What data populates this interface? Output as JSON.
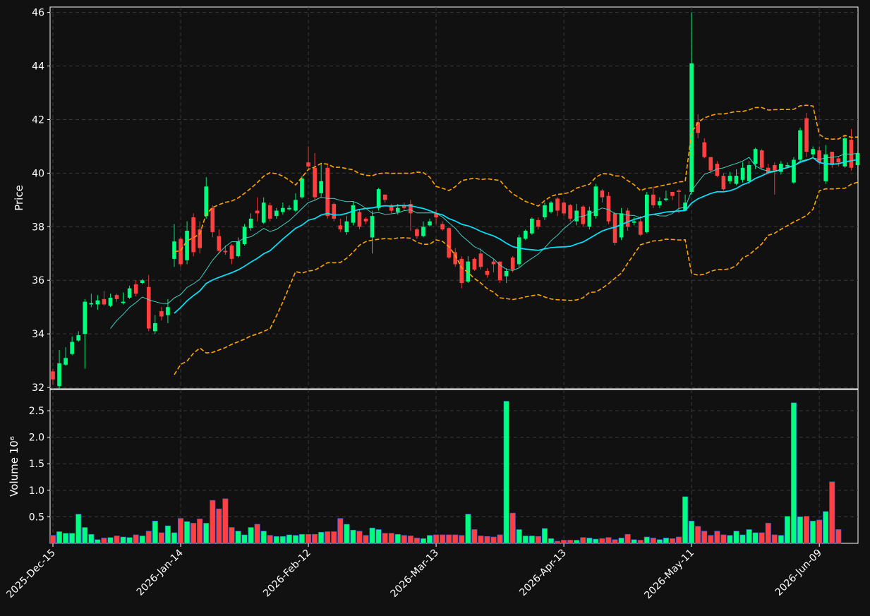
{
  "chart_data": {
    "type": "candlestick",
    "price_panel": {
      "ylabel": "Price",
      "ylim": [
        31.95,
        46.2
      ],
      "yticks": [
        32,
        34,
        36,
        38,
        40,
        42,
        44,
        46
      ],
      "grid": true,
      "overlays": [
        {
          "name": "",
          "style": "dashed",
          "color": "#FFA500",
          "kind": "bollinger-upper/lower"
        },
        {
          "name": "",
          "style": "solid",
          "color": "#00E5FF",
          "kind": "moving-average-long"
        },
        {
          "name": "",
          "style": "thin",
          "color": "#40E0D0",
          "kind": "moving-average-short"
        }
      ]
    },
    "volume_panel": {
      "ylabel": "Volume  10⁶",
      "ylim": [
        0,
        2.9
      ],
      "yticks": [
        0.5,
        1.0,
        1.5,
        2.0,
        2.5
      ],
      "yticklabels": [
        "0.5",
        "1.0",
        "1.5",
        "2.0",
        "2.5"
      ],
      "grid": true
    },
    "x_ticks": [
      {
        "index": 0,
        "label": "2025-Dec-15"
      },
      {
        "index": 20,
        "label": "2026-Jan-14"
      },
      {
        "index": 40,
        "label": "2026-Feb-12"
      },
      {
        "index": 60,
        "label": "2026-Mar-13"
      },
      {
        "index": 80,
        "label": "2026-Apr-13"
      },
      {
        "index": 100,
        "label": "2026-May-11"
      },
      {
        "index": 120,
        "label": "2026-Jun-09"
      }
    ],
    "up_color": "#00FF7F",
    "down_color": "#FF4040",
    "close": [
      32.3,
      32.9,
      33.1,
      33.7,
      33.95,
      35.2,
      35.15,
      35.25,
      35.1,
      35.35,
      35.3,
      35.2,
      35.7,
      35.5,
      36.0,
      34.2,
      34.4,
      34.65,
      35.0,
      37.45,
      36.6,
      37.85,
      37.05,
      37.2,
      39.5,
      37.8,
      37.1,
      37.05,
      36.8,
      37.45,
      38.0,
      38.3,
      38.5,
      38.9,
      38.3,
      38.6,
      38.7,
      38.7,
      39.0,
      39.8,
      40.25,
      39.1,
      39.7,
      38.4,
      38.3,
      37.9,
      38.2,
      38.8,
      38.0,
      38.2,
      38.4,
      39.4,
      39.0,
      38.6,
      38.7,
      38.7,
      38.5,
      37.65,
      38.0,
      38.2,
      38.35,
      37.9,
      36.85,
      36.6,
      35.9,
      36.7,
      36.4,
      36.5,
      36.2,
      36.6,
      36.0,
      36.35,
      36.4,
      37.6,
      37.85,
      38.3,
      38.0,
      38.8,
      38.9,
      38.6,
      38.5,
      38.3,
      38.6,
      38.1,
      38.6,
      39.5,
      39.1,
      38.2,
      37.4,
      38.5,
      38.0,
      38.2,
      37.7,
      39.2,
      38.8,
      38.95,
      39.05,
      39.15,
      39.3,
      38.9,
      44.1,
      41.5,
      40.6,
      40.1,
      39.9,
      39.4,
      39.9,
      39.9,
      40.2,
      40.3,
      40.9,
      40.2,
      40.0,
      40.1,
      40.35,
      40.3,
      40.5,
      41.6,
      40.8,
      40.9,
      40.4,
      40.7,
      40.3,
      40.4,
      41.3,
      40.2,
      40.75
    ],
    "open": [
      32.6,
      32.05,
      32.85,
      33.25,
      33.75,
      34.0,
      35.1,
      35.1,
      35.3,
      35.05,
      35.45,
      35.15,
      35.35,
      35.85,
      35.9,
      35.75,
      34.1,
      34.85,
      34.7,
      36.8,
      37.55,
      36.75,
      38.35,
      37.9,
      38.4,
      38.7,
      37.65,
      37.1,
      37.3,
      36.9,
      37.35,
      37.95,
      38.6,
      38.15,
      38.8,
      38.4,
      38.55,
      38.65,
      38.6,
      39.1,
      40.4,
      40.2,
      39.25,
      40.2,
      38.85,
      38.05,
      37.8,
      38.15,
      38.55,
      38.3,
      37.6,
      38.7,
      39.2,
      38.8,
      38.55,
      38.8,
      38.85,
      37.9,
      37.65,
      38.05,
      38.5,
      38.1,
      37.95,
      37.05,
      36.8,
      35.95,
      36.8,
      37.0,
      36.35,
      36.7,
      36.7,
      36.15,
      36.85,
      36.6,
      37.55,
      37.75,
      38.25,
      38.35,
      38.55,
      39.05,
      38.9,
      38.8,
      38.2,
      38.75,
      38.0,
      38.4,
      39.35,
      39.15,
      38.5,
      37.6,
      38.6,
      38.15,
      38.2,
      37.8,
      39.2,
      38.8,
      39.0,
      39.3,
      39.35,
      38.6,
      39.3,
      41.9,
      41.15,
      40.6,
      40.35,
      39.9,
      39.7,
      39.6,
      39.75,
      39.7,
      40.35,
      40.85,
      40.2,
      40.3,
      40.05,
      40.25,
      39.65,
      40.5,
      42.05,
      40.7,
      40.85,
      39.7,
      40.8,
      40.55,
      40.25,
      41.25,
      40.3
    ],
    "high": [
      32.7,
      33.4,
      33.5,
      33.9,
      34.1,
      35.3,
      35.5,
      35.45,
      35.6,
      35.5,
      35.5,
      35.55,
      35.8,
      36.0,
      36.05,
      36.2,
      34.7,
      35.0,
      35.3,
      38.1,
      37.6,
      38.2,
      38.5,
      38.2,
      39.85,
      38.8,
      37.9,
      37.3,
      37.35,
      37.6,
      38.1,
      38.5,
      39.1,
      39.1,
      38.9,
      38.7,
      38.9,
      38.8,
      39.25,
      39.9,
      41.0,
      40.75,
      40.35,
      40.35,
      38.9,
      38.3,
      38.4,
      38.95,
      38.65,
      38.35,
      38.6,
      39.45,
      39.2,
      38.85,
      38.85,
      38.9,
      39.0,
      37.95,
      38.2,
      38.3,
      38.65,
      38.2,
      38.0,
      37.2,
      36.9,
      36.9,
      36.85,
      37.2,
      36.45,
      36.8,
      36.7,
      36.45,
      36.9,
      37.7,
      37.9,
      38.35,
      38.35,
      38.9,
      38.95,
      39.1,
      38.95,
      38.85,
      38.85,
      38.8,
      38.75,
      39.6,
      39.4,
      39.3,
      38.55,
      38.7,
      38.7,
      38.35,
      38.4,
      39.3,
      39.5,
      39.1,
      39.35,
      39.3,
      39.4,
      39.2,
      46.0,
      42.2,
      41.3,
      40.6,
      40.45,
      40.0,
      40.05,
      40.15,
      40.4,
      40.45,
      40.95,
      40.9,
      40.35,
      40.4,
      40.45,
      40.4,
      40.6,
      41.7,
      42.25,
      41.0,
      41.0,
      41.05,
      40.8,
      40.6,
      41.4,
      41.65,
      40.8
    ],
    "low": [
      32.1,
      31.95,
      32.8,
      33.2,
      33.7,
      32.7,
      35.0,
      34.9,
      35.05,
      35.0,
      35.2,
      35.1,
      35.3,
      35.4,
      35.85,
      34.1,
      34.0,
      34.5,
      34.4,
      36.5,
      36.5,
      36.6,
      36.9,
      37.0,
      38.3,
      37.6,
      37.0,
      36.95,
      36.6,
      36.85,
      37.3,
      37.85,
      38.2,
      38.1,
      38.2,
      38.3,
      38.45,
      38.6,
      38.55,
      39.05,
      40.1,
      39.0,
      39.1,
      38.3,
      38.2,
      37.8,
      37.7,
      38.05,
      37.9,
      38.1,
      37.0,
      38.6,
      38.9,
      38.5,
      38.45,
      38.6,
      37.85,
      37.55,
      37.6,
      38.0,
      38.1,
      37.85,
      36.8,
      36.5,
      35.7,
      35.9,
      36.35,
      36.4,
      36.1,
      36.3,
      35.9,
      35.9,
      36.3,
      36.5,
      37.5,
      37.7,
      37.9,
      38.25,
      38.5,
      38.4,
      38.4,
      38.2,
      38.05,
      38.0,
      37.9,
      38.3,
      38.9,
      38.1,
      37.3,
      37.5,
      37.85,
      38.05,
      37.65,
      37.75,
      38.7,
      38.7,
      38.95,
      39.0,
      38.5,
      38.8,
      39.2,
      41.3,
      40.55,
      40.0,
      39.85,
      39.35,
      39.6,
      39.55,
      39.65,
      39.6,
      40.15,
      40.15,
      39.95,
      39.2,
      39.95,
      40.2,
      39.6,
      40.45,
      40.6,
      40.6,
      40.3,
      39.6,
      40.2,
      40.25,
      40.2,
      40.1,
      39.75
    ],
    "volume": [
      0.15,
      0.22,
      0.19,
      0.19,
      0.55,
      0.3,
      0.17,
      0.07,
      0.1,
      0.11,
      0.14,
      0.12,
      0.11,
      0.16,
      0.14,
      0.23,
      0.42,
      0.2,
      0.33,
      0.2,
      0.47,
      0.41,
      0.38,
      0.46,
      0.38,
      0.81,
      0.65,
      0.84,
      0.3,
      0.23,
      0.16,
      0.3,
      0.36,
      0.23,
      0.15,
      0.13,
      0.13,
      0.16,
      0.15,
      0.17,
      0.17,
      0.17,
      0.21,
      0.22,
      0.22,
      0.47,
      0.36,
      0.25,
      0.23,
      0.15,
      0.29,
      0.26,
      0.19,
      0.19,
      0.17,
      0.15,
      0.14,
      0.1,
      0.09,
      0.15,
      0.16,
      0.16,
      0.16,
      0.16,
      0.15,
      0.55,
      0.26,
      0.14,
      0.13,
      0.12,
      0.16,
      2.68,
      0.57,
      0.26,
      0.14,
      0.14,
      0.13,
      0.28,
      0.09,
      0.04,
      0.06,
      0.06,
      0.06,
      0.11,
      0.1,
      0.08,
      0.09,
      0.11,
      0.07,
      0.1,
      0.17,
      0.07,
      0.06,
      0.12,
      0.1,
      0.07,
      0.1,
      0.09,
      0.12,
      0.88,
      0.42,
      0.32,
      0.23,
      0.15,
      0.23,
      0.16,
      0.15,
      0.23,
      0.16,
      0.26,
      0.2,
      0.2,
      0.38,
      0.16,
      0.15,
      0.51,
      2.65,
      0.5,
      0.51,
      0.42,
      0.44,
      0.6,
      1.16,
      0.26
    ]
  }
}
